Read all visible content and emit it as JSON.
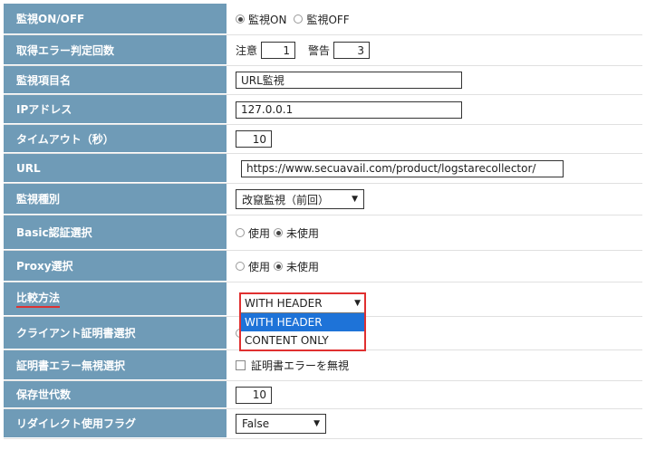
{
  "rows": {
    "monitor_onoff": {
      "label": "監視ON/OFF",
      "on": "監視ON",
      "off": "監視OFF",
      "selected": "on"
    },
    "error_count": {
      "label": "取得エラー判定回数",
      "caution_label": "注意",
      "caution_value": "1",
      "warning_label": "警告",
      "warning_value": "3"
    },
    "item_name": {
      "label": "監視項目名",
      "value": "URL監視"
    },
    "ip": {
      "label": "IPアドレス",
      "value": "127.0.0.1"
    },
    "timeout": {
      "label": "タイムアウト（秒）",
      "value": "10"
    },
    "url": {
      "label": "URL",
      "value": "https://www.secuavail.com/product/logstarecollector/"
    },
    "monitor_type": {
      "label": "監視種別",
      "value": "改竄監視（前回）"
    },
    "basic_auth": {
      "label": "Basic認証選択",
      "use": "使用",
      "unused": "未使用",
      "selected": "unused"
    },
    "proxy": {
      "label": "Proxy選択",
      "use": "使用",
      "unused": "未使用",
      "selected": "unused"
    },
    "compare": {
      "label": "比較方法",
      "value": "WITH HEADER",
      "options": [
        "WITH HEADER",
        "CONTENT ONLY"
      ],
      "highlighted": "WITH HEADER"
    },
    "client_cert": {
      "label": "クライアント証明書選択"
    },
    "cert_error": {
      "label": "証明書エラー無視選択",
      "checkbox_label": "証明書エラーを無視",
      "checked": false
    },
    "generations": {
      "label": "保存世代数",
      "value": "10"
    },
    "redirect": {
      "label": "リダイレクト使用フラグ",
      "value": "False"
    }
  }
}
